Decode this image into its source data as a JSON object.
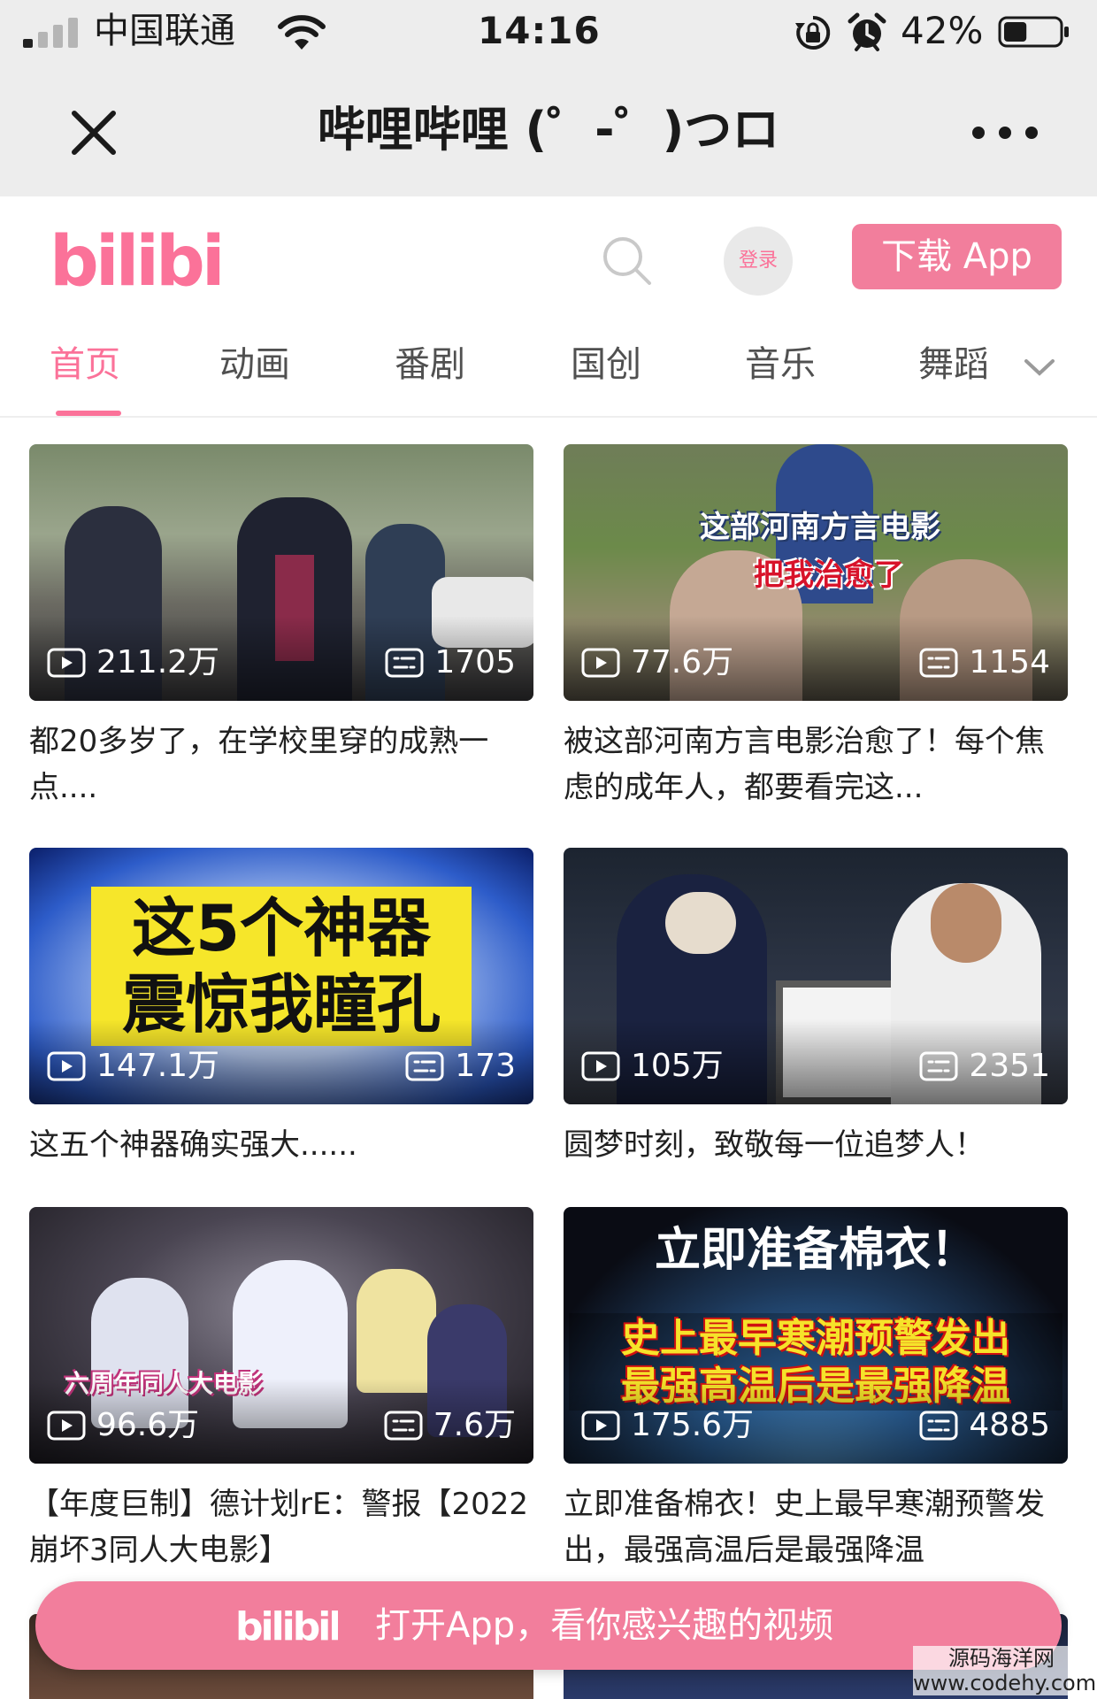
{
  "status_bar": {
    "carrier": "中国联通",
    "time": "14:16",
    "battery_percent": "42%",
    "battery_level": 0.42,
    "icons": [
      "signal-icon",
      "wifi-icon",
      "rotation-lock-icon",
      "alarm-icon",
      "battery-icon"
    ]
  },
  "titlebar": {
    "title": "哔哩哔哩 (゜-゜)つロ",
    "close_icon": "close-icon",
    "more_icon": "more-icon"
  },
  "header": {
    "logo_text": "bilibili",
    "search_icon": "search-icon",
    "login_label": "登录",
    "download_label": "下载 App"
  },
  "tabs": [
    {
      "label": "首页",
      "active": true
    },
    {
      "label": "动画",
      "active": false
    },
    {
      "label": "番剧",
      "active": false
    },
    {
      "label": "国创",
      "active": false
    },
    {
      "label": "音乐",
      "active": false
    },
    {
      "label": "舞蹈",
      "active": false
    }
  ],
  "videos": [
    {
      "views": "211.2万",
      "danmaku": "1705",
      "title": "都20多岁了，在学校里穿的成熟一点....",
      "thumb_text": []
    },
    {
      "views": "77.6万",
      "danmaku": "1154",
      "title": "被这部河南方言电影治愈了！每个焦虑的成年人，都要看完这...",
      "thumb_text": [
        "这部河南方言电影",
        "把我治愈了"
      ]
    },
    {
      "views": "147.1万",
      "danmaku": "173",
      "title": "这五个神器确实强大......",
      "thumb_text": [
        "这5个神器",
        "震惊我瞳孔"
      ]
    },
    {
      "views": "105万",
      "danmaku": "2351",
      "title": "圆梦时刻，致敬每一位追梦人！",
      "thumb_text": []
    },
    {
      "views": "96.6万",
      "danmaku": "7.6万",
      "title": "【年度巨制】德计划rE：警报【2022崩坏3同人大电影】",
      "thumb_text": [
        "六周年同人大电影"
      ]
    },
    {
      "views": "175.6万",
      "danmaku": "4885",
      "title": "立即准备棉衣！史上最早寒潮预警发出，最强高温后是最强降温",
      "thumb_text": [
        "立即准备棉衣！",
        "史上最早寒潮预警发出",
        "最强高温后是最强降温"
      ]
    }
  ],
  "banner": {
    "logo_text": "bilibili",
    "text": "打开App，看你感兴趣的视频"
  },
  "watermark": {
    "line1": "源码海洋网",
    "line2": "www.codehy.com"
  },
  "colors": {
    "brand_pink": "#fb7299",
    "button_pink": "#f27e9c",
    "chrome_gray": "#ededed"
  }
}
